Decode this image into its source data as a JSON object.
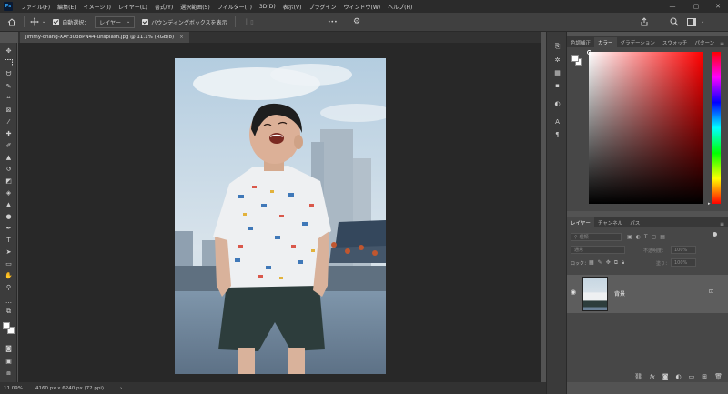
{
  "app": {
    "logo": "Ps"
  },
  "menu": [
    "ファイル(F)",
    "編集(E)",
    "イメージ(I)",
    "レイヤー(L)",
    "書式(Y)",
    "選択範囲(S)",
    "フィルター(T)",
    "3D(D)",
    "表示(V)",
    "プラグイン",
    "ウィンドウ(W)",
    "ヘルプ(H)"
  ],
  "options": {
    "auto_select_label": "自動選択：",
    "auto_select_value": "レイヤー",
    "bounding_box_label": "バウンディングボックスを表示",
    "more": "•••"
  },
  "document": {
    "tab_title": "jimmy-chang-XAF3038PN44-unsplash.jpg @ 11.1% (RGB/8)",
    "close": "×"
  },
  "status": {
    "zoom": "11.09%",
    "dimensions": "4160 px x 6240 px (72 ppi)",
    "arrow": "›"
  },
  "color_panel": {
    "tabs": [
      "色調補正",
      "カラー",
      "グラデーション",
      "スウォッチ",
      "パターン"
    ],
    "active_tab": 1,
    "hue_color": "#ff0000"
  },
  "layers_panel": {
    "tabs": [
      "レイヤー",
      "チャンネル",
      "パス"
    ],
    "active_tab": 0,
    "filter_placeholder": "種類",
    "blend_mode": "通常",
    "opacity_label": "不透明度：",
    "opacity_value": "100%",
    "lock_label": "ロック：",
    "fill_label": "塗り：",
    "fill_value": "100%",
    "layer_name": "背景"
  },
  "colors": {
    "menubar": "#2b2b2b",
    "panel": "#474747",
    "canvas": "#282828",
    "selected_layer": "#5d5d5d"
  }
}
